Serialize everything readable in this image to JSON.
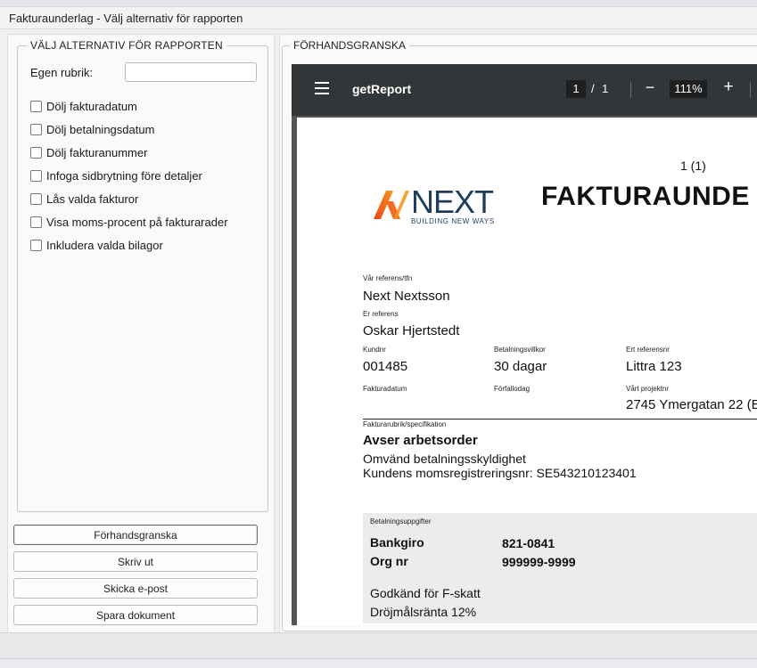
{
  "window": {
    "title": "Fakturaunderlag - Välj alternativ för rapporten"
  },
  "options": {
    "legend": "VÄLJ ALTERNATIV FÖR RAPPORTEN",
    "custom_heading_label": "Egen rubrik:",
    "custom_heading_value": "",
    "checkboxes": [
      {
        "label": "Dölj fakturadatum",
        "checked": false
      },
      {
        "label": "Dölj betalningsdatum",
        "checked": false
      },
      {
        "label": "Dölj fakturanummer",
        "checked": false
      },
      {
        "label": "Infoga sidbrytning före detaljer",
        "checked": false
      },
      {
        "label": "Lås valda fakturor",
        "checked": false
      },
      {
        "label": "Visa moms-procent på fakturarader",
        "checked": false
      },
      {
        "label": "Inkludera valda bilagor",
        "checked": false
      }
    ]
  },
  "buttons": {
    "preview": "Förhandsgranska",
    "print": "Skriv ut",
    "email": "Skicka e-post",
    "save": "Spara dokument"
  },
  "preview": {
    "legend": "FÖRHANDSGRANSKA",
    "viewer": {
      "doc_title": "getReport",
      "current_page": "1",
      "page_separator": "/",
      "total_pages": "1",
      "zoom": "111%",
      "zoom_out_symbol": "−",
      "zoom_in_symbol": "+"
    },
    "document": {
      "page_indicator": "1 (1)",
      "logo_word": "NEXT",
      "logo_tagline": "BUILDING NEW WAYS",
      "heading": "FAKTURAUNDE",
      "our_reference_label": "Vår referens/tfn",
      "our_reference_value": "Next Nextsson",
      "your_reference_label": "Er referens",
      "your_reference_value": "Oskar Hjertstedt",
      "customer_no_label": "Kundnr",
      "customer_no_value": "001485",
      "payment_terms_label": "Betalningsvillkor",
      "payment_terms_value": "30 dagar",
      "your_ref_no_label": "Ert referensnr",
      "your_ref_no_value": "Littra 123",
      "invoice_date_label": "Fakturadatum",
      "due_date_label": "Förfallodag",
      "our_project_label": "Vårt projektnr",
      "our_project_value": "2745 Ymergatan 22 (E",
      "spec_label": "Fakturarubrik/specifikation",
      "spec_title": "Avser arbetsorder",
      "spec_line1": "Omvänd betalningsskyldighet",
      "spec_line2": "Kundens momsregistreringsnr: SE543210123401",
      "payment_label": "Betalningsuppgifter",
      "bankgiro_label": "Bankgiro",
      "bankgiro_value": "821-0841",
      "orgnr_label": "Org nr",
      "orgnr_value": "999999-9999",
      "fskatt_note": "Godkänd för F-skatt",
      "interest_note": "Dröjmålsränta 12%"
    }
  },
  "colors": {
    "viewer_toolbar": "#323639",
    "viewer_background": "#525659",
    "logo_navy": "#1f3d5a",
    "logo_orange": "#f05a28"
  }
}
